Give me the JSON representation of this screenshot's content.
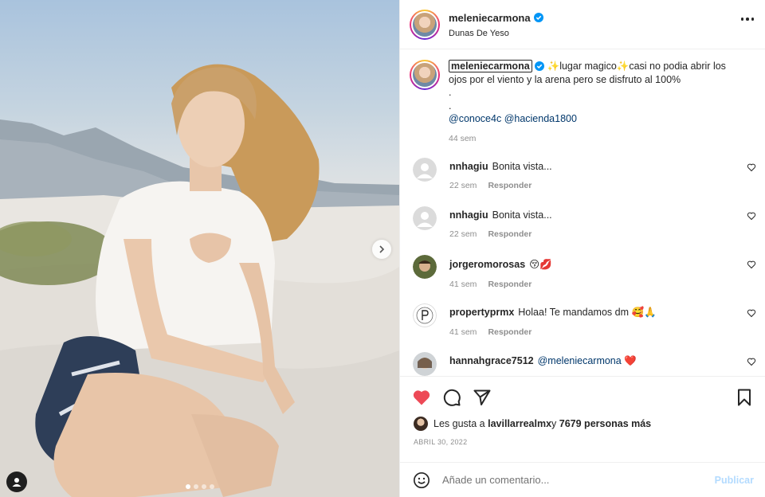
{
  "post": {
    "username": "meleniecarmona",
    "location": "Dunas De Yeso",
    "verified": true,
    "carousel": {
      "slide_count": 4,
      "active_slide": 1
    }
  },
  "caption": {
    "username": "meleniecarmona",
    "line1": "✨lugar magico✨casi no podia abrir los",
    "line2": "ojos por el viento y la arena pero se disfruto al 100%",
    "line3": ".",
    "line4": ".",
    "mention1": "@conoce4c",
    "mention2": "@hacienda1800",
    "time": "44 sem"
  },
  "comments": [
    {
      "username": "nnhagiu",
      "text": "Bonita vista...",
      "time": "22 sem",
      "reply_label": "Responder",
      "avatar": "default-avatar"
    },
    {
      "username": "nnhagiu",
      "text": "Bonita vista...",
      "time": "22 sem",
      "reply_label": "Responder",
      "avatar": "default-avatar"
    },
    {
      "username": "jorgeromorosas",
      "text": "😚💋",
      "time": "41 sem",
      "reply_label": "Responder",
      "avatar": "photo-avatar"
    },
    {
      "username": "propertyprmx",
      "text": "Holaa! Te mandamos dm 🥰🙏",
      "time": "41 sem",
      "reply_label": "Responder",
      "avatar": "logo-avatar"
    },
    {
      "username": "hannahgrace7512",
      "text": "@meleniecarmona ❤️",
      "time": "",
      "reply_label": "",
      "avatar": "photo-avatar"
    }
  ],
  "likes": {
    "prefix": "Les gusta a ",
    "user": "lavillarrealmx",
    "middle": " y ",
    "others": "7679 personas más"
  },
  "date": "ABRIL 30, 2022",
  "comment_input": {
    "placeholder": "Añade un comentario...",
    "value": ""
  },
  "publish_label": "Publicar",
  "colors": {
    "like_red": "#ed4956",
    "link_blue": "#00376b",
    "publish_disabled": "#b3dbff",
    "verified_blue": "#0095f6",
    "muted": "#8e8e8e"
  },
  "liked": true
}
